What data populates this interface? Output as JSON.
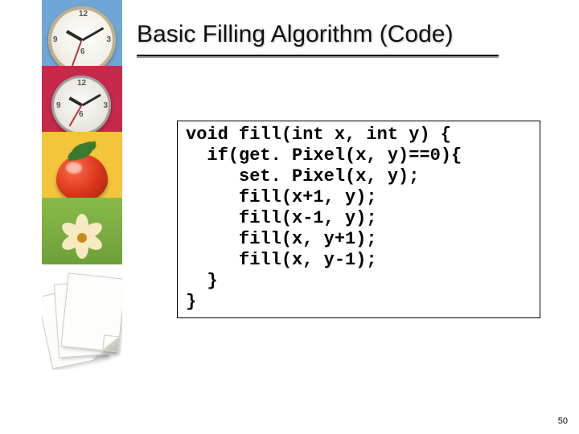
{
  "title": "Basic Filling Algorithm (Code)",
  "code": {
    "l1": "void fill(int x, int y) {",
    "l2": "  if(get. Pixel(x, y)==0){",
    "l3": "     set. Pixel(x, y);",
    "l4": "     fill(x+1, y);",
    "l5": "     fill(x-1, y);",
    "l6": "     fill(x, y+1);",
    "l7": "     fill(x, y-1);",
    "l8": "  }",
    "l9": "}"
  },
  "page_number": "50"
}
